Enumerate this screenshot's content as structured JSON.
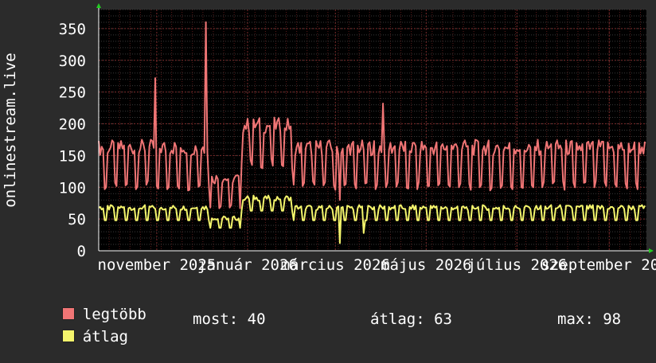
{
  "chart_data": {
    "type": "line",
    "ylabel": "onlinestream.live",
    "ylim": [
      0,
      380
    ],
    "yticks": [
      0,
      50,
      100,
      150,
      200,
      250,
      300,
      350
    ],
    "x_range": [
      "2025-09-23",
      "2026-09-26"
    ],
    "xticks": [
      {
        "date": "2025-11-01",
        "label": "november 2025"
      },
      {
        "date": "2026-01-01",
        "label": "január 2026"
      },
      {
        "date": "2026-03-01",
        "label": "március 2026"
      },
      {
        "date": "2026-05-01",
        "label": "május 2026"
      },
      {
        "date": "2026-07-01",
        "label": "július 2026"
      },
      {
        "date": "2026-09-01",
        "label": "szeptember 2026"
      }
    ],
    "grid": true,
    "series": [
      {
        "name": "legtöbb",
        "color": "#f07575",
        "values": []
      },
      {
        "name": "átlag",
        "color": "#f4f46c",
        "values": []
      }
    ]
  },
  "legend": {
    "items": [
      {
        "label": "legtöbb",
        "color": "#f07575"
      },
      {
        "label": "átlag",
        "color": "#f4f46c"
      }
    ],
    "stats": {
      "now": "most: 40",
      "avg": "átlag: 63",
      "max": "max: 98"
    }
  }
}
